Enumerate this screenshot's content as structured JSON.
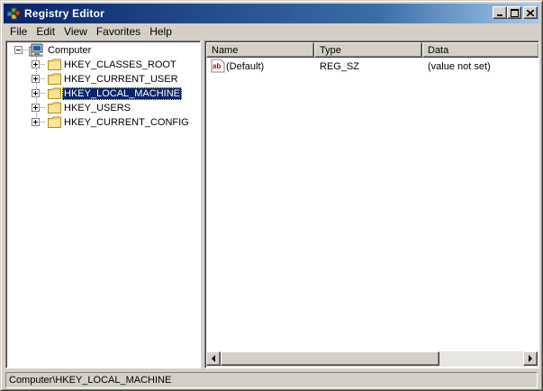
{
  "window": {
    "title": "Registry Editor",
    "icon": "registry-editor-icon",
    "controls": {
      "minimize": "minimize-icon",
      "maximize": "maximize-icon",
      "close": "close-icon"
    }
  },
  "menu": [
    {
      "label": "File"
    },
    {
      "label": "Edit"
    },
    {
      "label": "View"
    },
    {
      "label": "Favorites"
    },
    {
      "label": "Help"
    }
  ],
  "tree": {
    "root": {
      "label": "Computer",
      "icon": "computer-icon",
      "expanded": true
    },
    "items": [
      {
        "label": "HKEY_CLASSES_ROOT",
        "icon": "folder-icon",
        "selected": false
      },
      {
        "label": "HKEY_CURRENT_USER",
        "icon": "folder-icon",
        "selected": false
      },
      {
        "label": "HKEY_LOCAL_MACHINE",
        "icon": "folder-icon",
        "selected": true
      },
      {
        "label": "HKEY_USERS",
        "icon": "folder-icon",
        "selected": false
      },
      {
        "label": "HKEY_CURRENT_CONFIG",
        "icon": "folder-icon",
        "selected": false
      }
    ]
  },
  "list": {
    "columns": [
      {
        "label": "Name"
      },
      {
        "label": "Type"
      },
      {
        "label": "Data"
      }
    ],
    "rows": [
      {
        "icon": "string-value-icon",
        "name": "(Default)",
        "type": "REG_SZ",
        "data": "(value not set)"
      }
    ]
  },
  "status": {
    "path": "Computer\\HKEY_LOCAL_MACHINE"
  },
  "colors": {
    "title_gradient_start": "#0a246a",
    "title_gradient_end": "#a6caf0",
    "selection": "#0a246a",
    "face": "#d4d0c8"
  }
}
